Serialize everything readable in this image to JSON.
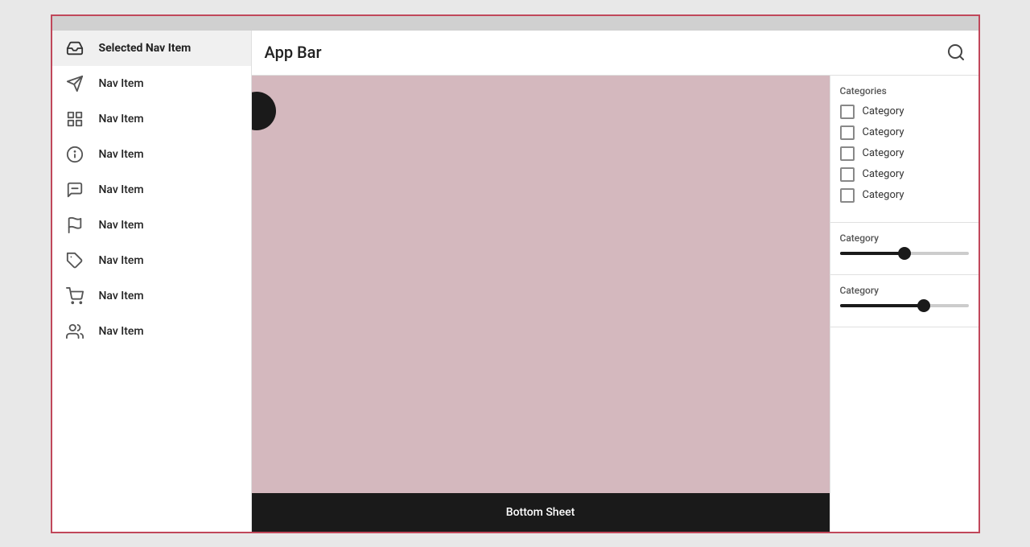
{
  "app": {
    "title": "App Bar",
    "top_bar_color": "#d0d0d0",
    "border_color": "#c0475a"
  },
  "sidebar": {
    "items": [
      {
        "id": "selected",
        "label": "Selected Nav Item",
        "icon": "inbox-icon",
        "selected": true
      },
      {
        "id": "nav1",
        "label": "Nav Item",
        "icon": "send-icon",
        "selected": false
      },
      {
        "id": "nav2",
        "label": "Nav Item",
        "icon": "list-icon",
        "selected": false
      },
      {
        "id": "nav3",
        "label": "Nav Item",
        "icon": "info-icon",
        "selected": false
      },
      {
        "id": "nav4",
        "label": "Nav Item",
        "icon": "chat-icon",
        "selected": false
      },
      {
        "id": "nav5",
        "label": "Nav Item",
        "icon": "flag-icon",
        "selected": false
      },
      {
        "id": "nav6",
        "label": "Nav Item",
        "icon": "tag-icon",
        "selected": false
      },
      {
        "id": "nav7",
        "label": "Nav Item",
        "icon": "cart-icon",
        "selected": false
      },
      {
        "id": "nav8",
        "label": "Nav Item",
        "icon": "people-icon",
        "selected": false
      }
    ]
  },
  "right_panel": {
    "categories_title": "Categories",
    "categories": [
      {
        "label": "Category",
        "checked": false
      },
      {
        "label": "Category",
        "checked": false
      },
      {
        "label": "Category",
        "checked": false
      },
      {
        "label": "Category",
        "checked": false
      },
      {
        "label": "Category",
        "checked": false
      }
    ],
    "slider1": {
      "title": "Category",
      "value": 50,
      "percent": 50
    },
    "slider2": {
      "title": "Category",
      "value": 65,
      "percent": 65
    }
  },
  "bottom_sheet": {
    "label": "Bottom Sheet"
  },
  "icons": {
    "search": "🔍",
    "inbox": "📥",
    "send": "➤",
    "list": "☰",
    "info": "ℹ",
    "chat": "💬",
    "flag": "⚑",
    "tag": "🏷",
    "cart": "🛒",
    "people": "👥"
  }
}
